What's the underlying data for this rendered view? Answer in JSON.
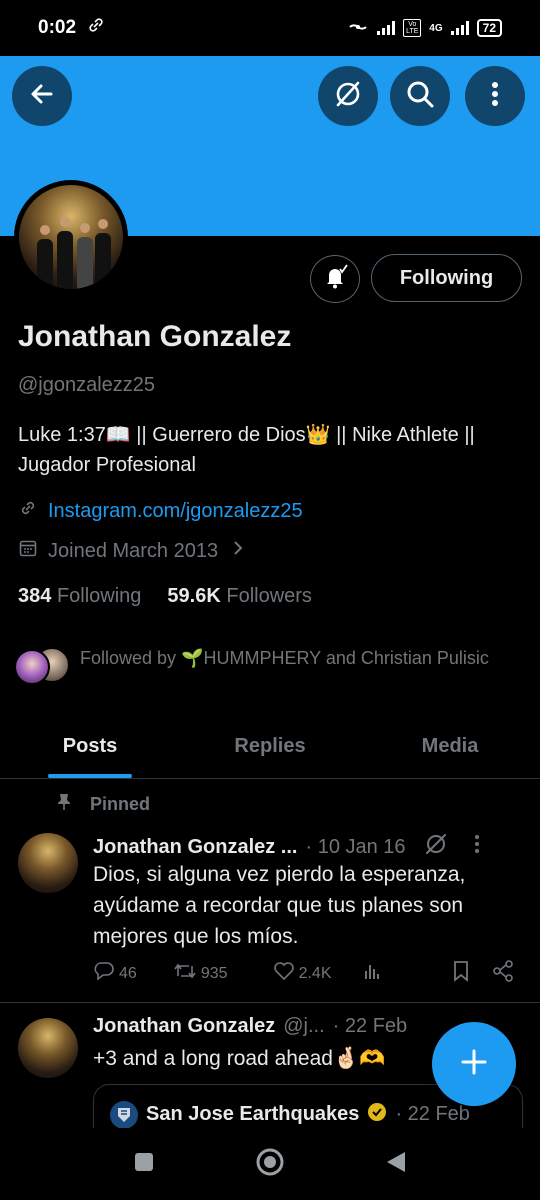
{
  "status": {
    "time": "0:02",
    "battery": "72",
    "network": "4G",
    "volte": "Vo LTE"
  },
  "profile": {
    "name": "Jonathan Gonzalez",
    "handle": "@jgonzalezz25",
    "bio": "Luke 1:37📖 || Guerrero de Dios👑 || Nike Athlete || Jugador Profesional",
    "website": "Instagram.com/jgonzalezz25",
    "joined": "Joined March 2013",
    "following_count": "384",
    "following_label": "Following",
    "followers_count": "59.6K",
    "followers_label": "Followers",
    "followed_by": "Followed by 🌱HUMMPHERY and Christian Pulisic",
    "follow_button": "Following"
  },
  "tabs": [
    {
      "label": "Posts",
      "active": true
    },
    {
      "label": "Replies",
      "active": false
    },
    {
      "label": "Media",
      "active": false
    }
  ],
  "tweets": [
    {
      "pinned_label": "Pinned",
      "name": "Jonathan Gonzalez ...",
      "meta": "· 10 Jan 16",
      "text": "Dios, si alguna vez pierdo la esperanza, ayúdame a recordar que tus planes son mejores que los míos.",
      "replies": "46",
      "reposts": "935",
      "likes": "2.4K"
    },
    {
      "name": "Jonathan Gonzalez",
      "handle": "@j...",
      "meta": "· 22 Feb",
      "text": "+3 and a long road ahead🤞🏻🫶",
      "quote": {
        "name": "San Jose Earthquakes",
        "meta": "· 22 Feb"
      }
    }
  ],
  "colors": {
    "accent": "#1d9bf0",
    "background": "#000000",
    "text": "#e7e9ea",
    "muted": "#71767b"
  }
}
